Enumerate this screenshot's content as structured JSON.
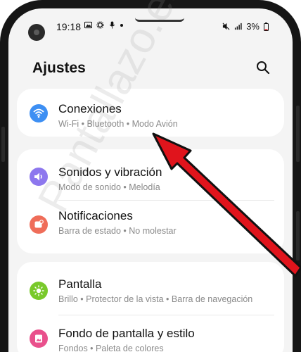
{
  "status_bar": {
    "time": "19:18",
    "battery": "3%"
  },
  "header": {
    "title": "Ajustes"
  },
  "settings": [
    {
      "title": "Conexiones",
      "subtitle": "Wi-Fi  •  Bluetooth  •  Modo Avión",
      "icon": "wifi-icon",
      "color": "#3d8ff3"
    },
    {
      "title": "Sonidos y vibración",
      "subtitle": "Modo de sonido  •  Melodía",
      "icon": "speaker-icon",
      "color": "#8d77ee"
    },
    {
      "title": "Notificaciones",
      "subtitle": "Barra de estado  •  No molestar",
      "icon": "notification-icon",
      "color": "#ef6d59"
    },
    {
      "title": "Pantalla",
      "subtitle": "Brillo  •  Protector de la vista  •  Barra de navegación",
      "icon": "brightness-icon",
      "color": "#79c92b"
    },
    {
      "title": "Fondo de pantalla y estilo",
      "subtitle": "Fondos  •  Paleta de colores",
      "icon": "wallpaper-icon",
      "color": "#e9508c"
    }
  ],
  "watermark": "Pantallazo.es",
  "colors": {
    "background": "#f4f4f4",
    "card": "#ffffff",
    "arrow": "#e0141c"
  }
}
